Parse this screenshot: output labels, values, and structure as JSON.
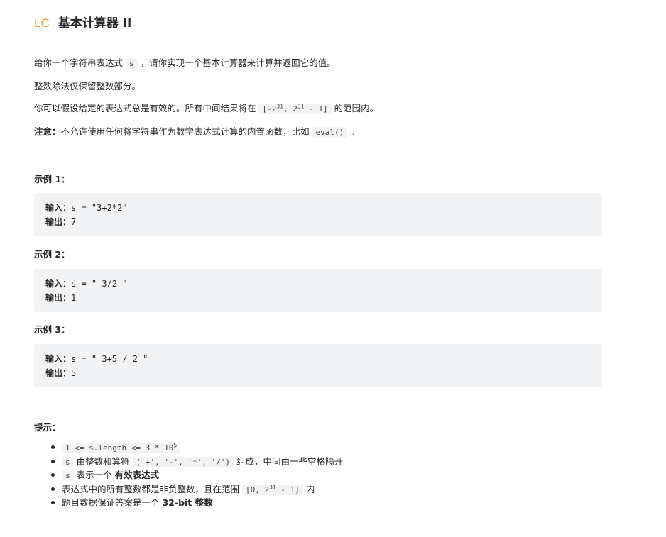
{
  "header": {
    "badge": "LC",
    "title": "基本计算器 II"
  },
  "description": {
    "p1_pre": "给你一个字符串表达式 ",
    "p1_code": "s",
    "p1_post": " ，请你实现一个基本计算器来计算并返回它的值。",
    "p2": "整数除法仅保留整数部分。",
    "p3_pre": "你可以假设给定的表达式总是有效的。所有中间结果将在 ",
    "p3_code_a": "[-2",
    "p3_sup_a": "31",
    "p3_code_b": ", 2",
    "p3_sup_b": "31",
    "p3_code_c": " - 1]",
    "p3_post": " 的范围内。",
    "note_label": "注意：",
    "note_text": "不允许使用任何将字符串作为数学表达式计算的内置函数，比如 ",
    "note_code": "eval()",
    "note_post": " 。"
  },
  "examples": [
    {
      "heading": "示例 1：",
      "input_label": "输入：",
      "input": "s = \"3+2*2\"",
      "output_label": "输出：",
      "output": "7"
    },
    {
      "heading": "示例 2：",
      "input_label": "输入：",
      "input": "s = \" 3/2 \"",
      "output_label": "输出：",
      "output": "1"
    },
    {
      "heading": "示例 3：",
      "input_label": "输入：",
      "input": "s = \" 3+5 / 2 \"",
      "output_label": "输出：",
      "output": "5"
    }
  ],
  "hints": {
    "heading": "提示：",
    "h1_code": "1 <= s.length <= 3 * 10",
    "h1_sup": "5",
    "h2_code": "s",
    "h2_text": " 由整数和算符 ",
    "h2_code2": "('+', '-', '*', '/')",
    "h2_post": " 组成，中间由一些空格隔开",
    "h3_code": "s",
    "h3_text": " 表示一个 ",
    "h3_strong": "有效表达式",
    "h4_text": "表达式中的所有整数都是非负整数，且在范围 ",
    "h4_code_a": "[0, 2",
    "h4_sup": "31",
    "h4_code_b": " - 1]",
    "h4_post": " 内",
    "h5_text": "题目数据保证答案是一个 ",
    "h5_strong": "32-bit 整数"
  }
}
